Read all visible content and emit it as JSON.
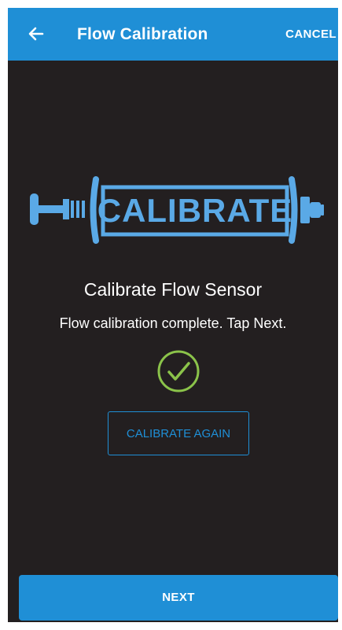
{
  "app_bar": {
    "back_icon": "arrow-left-icon",
    "title": "Flow Calibration",
    "cancel_label": "CANCEL"
  },
  "illustration": {
    "icon": "syringe-calibrate-illustration",
    "label": "CALIBRATE"
  },
  "content": {
    "heading": "Calibrate Flow Sensor",
    "message": "Flow calibration complete. Tap Next.",
    "status_icon": "check-circle-icon"
  },
  "actions": {
    "calibrate_again_label": "CALIBRATE AGAIN",
    "next_label": "NEXT"
  },
  "colors": {
    "accent": "#1f8fd6",
    "background": "#231f20",
    "success": "#8bc34a",
    "illustration": "#5aa9e6"
  }
}
